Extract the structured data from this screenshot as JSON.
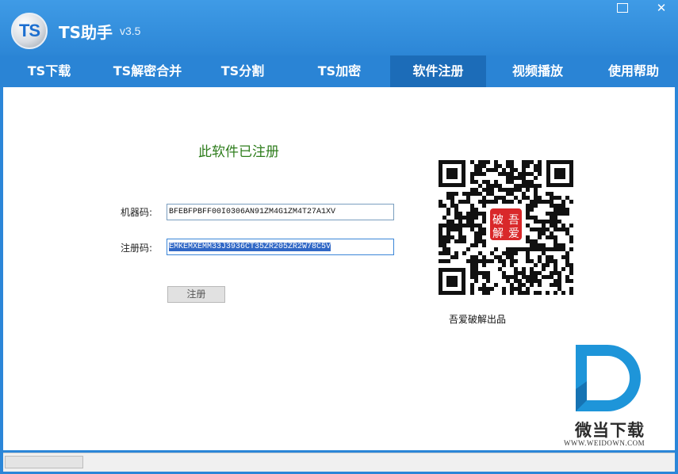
{
  "app": {
    "logo_text": "TS",
    "title": "TS助手",
    "version": "v3.5"
  },
  "window_controls": {
    "minimize": "▭",
    "close": "✕"
  },
  "tabs": [
    {
      "label": "TS下载",
      "active": false
    },
    {
      "label": "TS解密合并",
      "active": false
    },
    {
      "label": "TS分割",
      "active": false
    },
    {
      "label": "TS加密",
      "active": false
    },
    {
      "label": "软件注册",
      "active": true
    },
    {
      "label": "视频播放",
      "active": false
    },
    {
      "label": "使用帮助",
      "active": false
    }
  ],
  "registration": {
    "status": "此软件已注册",
    "machine_code_label": "机器码:",
    "machine_code_value": "BFEBFPBFF00I0306AN91ZM4G1ZM4T27A1XV",
    "reg_code_label": "注册码:",
    "reg_code_value": "EMKEMXEMM33J3936CT35ZR205ZR2W78C5V",
    "register_button": "注册"
  },
  "qr": {
    "stamp_chars": [
      "吾",
      "破",
      "爱",
      "解"
    ],
    "caption": "吾爱破解出品"
  },
  "watermark": {
    "title": "微当下载",
    "url": "WWW.WEIDOWN.COM"
  },
  "statusbar": {
    "progress": 0
  },
  "colors": {
    "accent": "#2b86d8",
    "tab_active": "#1c6cb8",
    "status_green": "#2e7d1c",
    "stamp_red": "#d9282a"
  }
}
